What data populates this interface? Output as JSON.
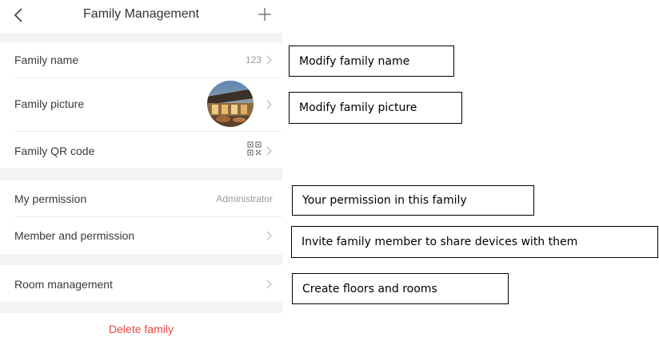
{
  "header": {
    "title": "Family Management",
    "back_icon": "chevron-left-icon",
    "add_icon": "plus-icon"
  },
  "rows": {
    "family_name": {
      "label": "Family name",
      "value": "123"
    },
    "family_picture": {
      "label": "Family picture"
    },
    "family_qr": {
      "label": "Family QR code"
    },
    "my_permission": {
      "label": "My permission",
      "value": "Administrator"
    },
    "member_permission": {
      "label": "Member and permission"
    },
    "room_management": {
      "label": "Room management"
    }
  },
  "delete": {
    "label": "Delete family"
  },
  "annotations": {
    "family_name": "Modify family name",
    "family_picture": "Modify family picture",
    "my_permission": "Your permission in this family",
    "member_permission": "Invite family member to share devices with them",
    "room_management": "Create floors and rooms"
  },
  "colors": {
    "delete_red": "#e8463d",
    "section_gap": "#f3f3f3",
    "muted_text": "#9a9a9a"
  }
}
